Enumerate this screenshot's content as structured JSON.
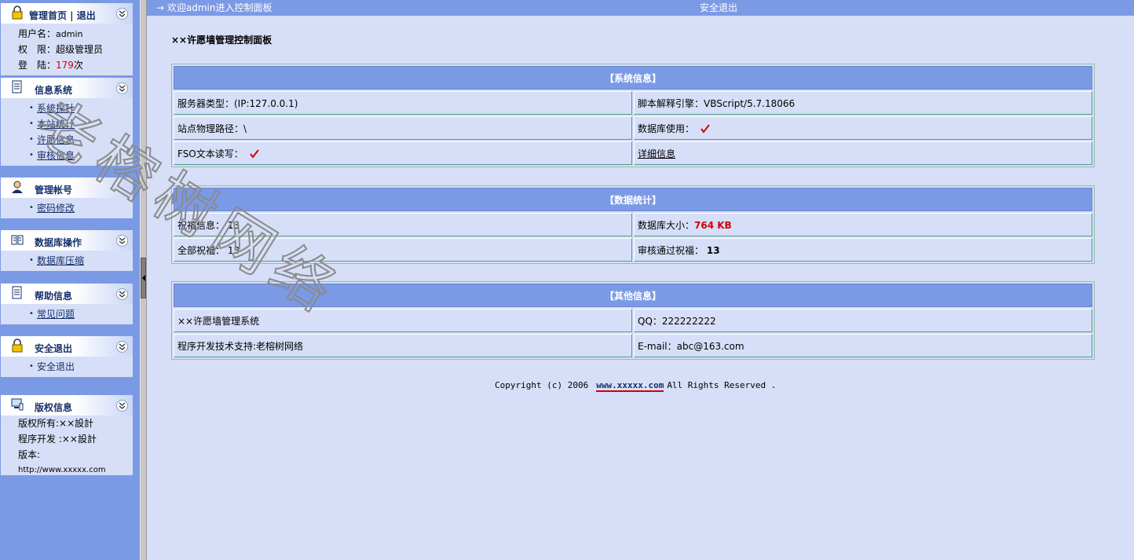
{
  "sidebar": {
    "panels": [
      {
        "title": "管理首页 | 退出",
        "icon": "lock-icon"
      },
      {
        "title": "信息系统",
        "icon": "document-icon"
      },
      {
        "title": "管理帐号",
        "icon": "user-icon"
      },
      {
        "title": "数据库操作",
        "icon": "book-icon"
      },
      {
        "title": "帮助信息",
        "icon": "document-icon"
      },
      {
        "title": "安全退出",
        "icon": "lock-icon"
      },
      {
        "title": "版权信息",
        "icon": "computer-icon"
      }
    ],
    "user": {
      "username_label": "用户名：",
      "username": "admin",
      "role_label": "权　限：",
      "role": "超级管理员",
      "login_label": "登　陆：",
      "login_count": "179",
      "login_suffix": "次"
    },
    "info_links": [
      "系统探针",
      "本站统计",
      "许愿信息",
      "审核信息"
    ],
    "account_links": [
      "密码修改"
    ],
    "db_links": [
      "数据库压缩"
    ],
    "help_links": [
      "常见问题"
    ],
    "logout_links": [
      "安全退出"
    ],
    "copyright": {
      "owner": "版权所有:××設計",
      "dev": "程序开发 :××設計",
      "version": "版本:",
      "url": "http://www.xxxxx.com"
    }
  },
  "topbar": {
    "arrow": "→",
    "welcome": "欢迎admin进入控制面板",
    "logout": "安全退出"
  },
  "page_title": "××许愿墙管理控制面板",
  "system_info": {
    "header": "【系统信息】",
    "rows": [
      {
        "left": "服务器类型：(IP:127.0.0.1)",
        "right": "脚本解释引擎：VBScript/5.7.18066"
      },
      {
        "left": "站点物理路径：\\",
        "right": "数据库使用：",
        "right_check": true
      },
      {
        "left": "FSO文本读写：",
        "left_check": true,
        "right_link": "详细信息"
      }
    ]
  },
  "stats": {
    "header": "【数据统计】",
    "rows": [
      {
        "left": "祝福信息：",
        "left_value": "13",
        "right": "数据库大小：",
        "right_value": "764 KB"
      },
      {
        "left": "全部祝福：",
        "left_value": "13",
        "right": "审核通过祝福：",
        "right_value": "13"
      }
    ]
  },
  "other_info": {
    "header": "【其他信息】",
    "rows": [
      {
        "left": "××许愿墙管理系统",
        "right": "QQ：222222222"
      },
      {
        "left": "程序开发技术支持:老榕树网络",
        "right": "E-mail：abc@163.com"
      }
    ]
  },
  "footer": {
    "prefix": "Copyright (c) 2006",
    "link": "www.xxxxx.com",
    "suffix": "All Rights Reserved ."
  },
  "watermark": "老榕树网络",
  "colors": {
    "sidebar": "#7b9ae6",
    "content_bg": "#d6dff7",
    "header": "#7b9ae6",
    "accent_red": "#d40000"
  }
}
